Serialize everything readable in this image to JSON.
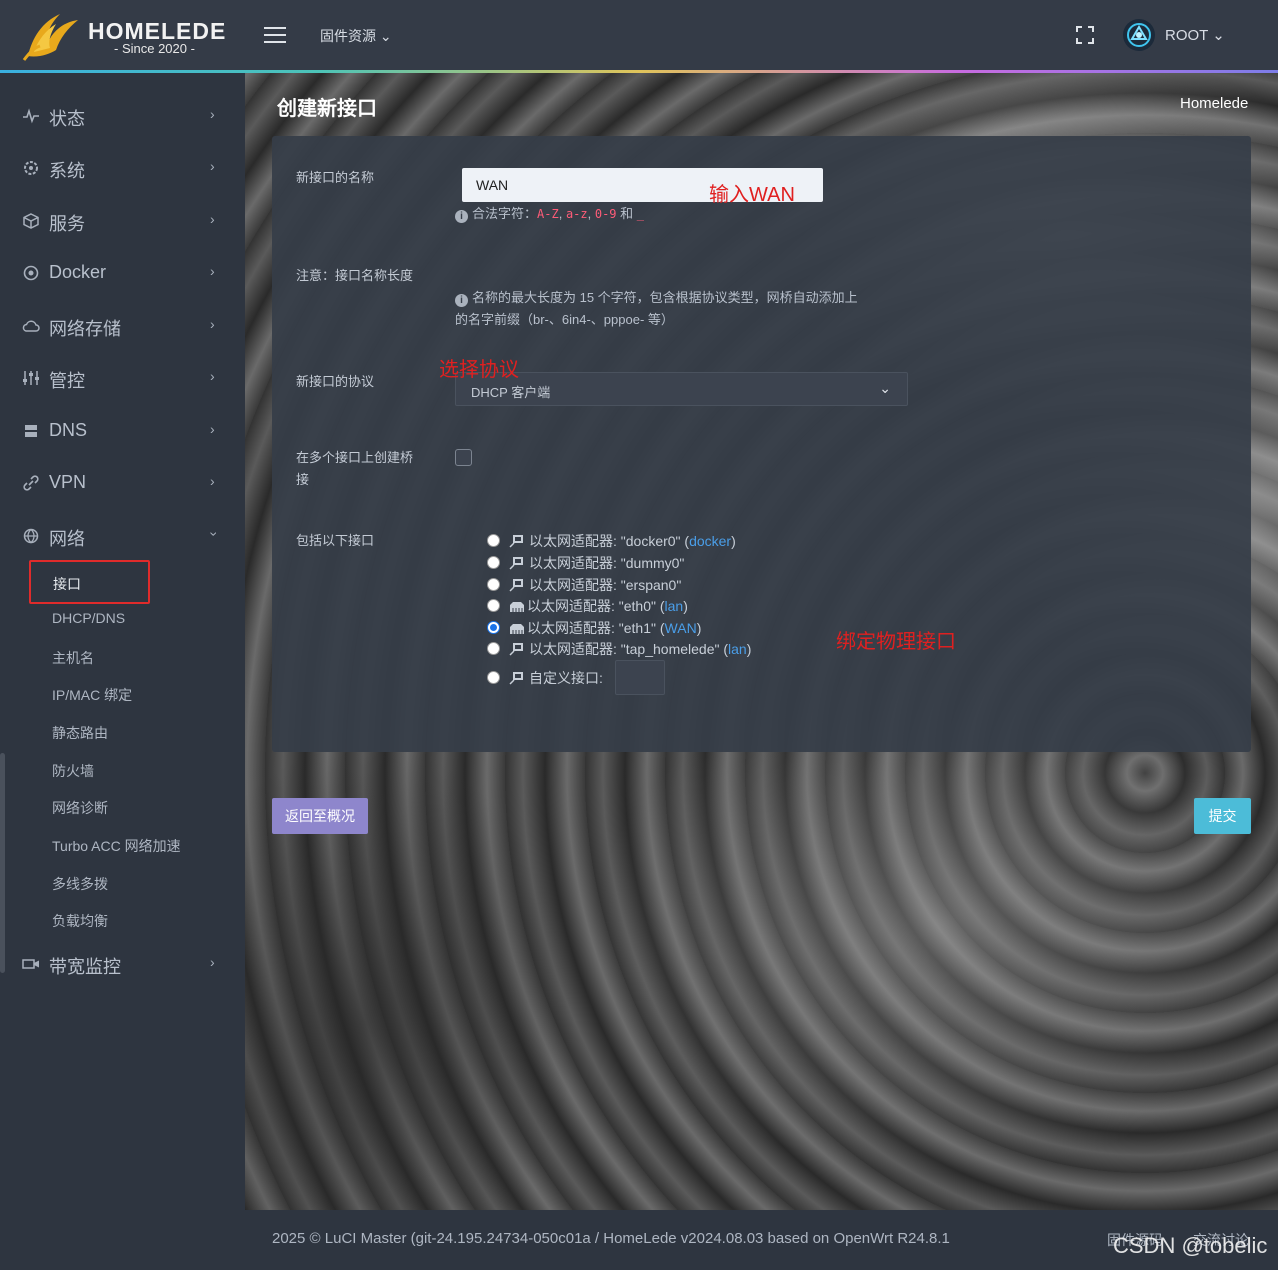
{
  "header": {
    "logo_title": "HOMELEDE",
    "logo_subtitle": "- Since 2020 -",
    "firmware_menu": "固件资源 ⌄",
    "user": "ROOT ⌄"
  },
  "sidebar": {
    "items": [
      {
        "label": "状态",
        "icon": "pulse-icon"
      },
      {
        "label": "系统",
        "icon": "gear-icon"
      },
      {
        "label": "服务",
        "icon": "cube-icon"
      },
      {
        "label": "Docker",
        "icon": "target-icon"
      },
      {
        "label": "网络存储",
        "icon": "cloud-icon"
      },
      {
        "label": "管控",
        "icon": "sliders-icon"
      },
      {
        "label": "DNS",
        "icon": "server-icon"
      },
      {
        "label": "VPN",
        "icon": "link-icon"
      },
      {
        "label": "网络",
        "icon": "globe-icon"
      },
      {
        "label": "带宽监控",
        "icon": "camera-icon"
      }
    ],
    "network_sub": [
      "接口",
      "DHCP/DNS",
      "主机名",
      "IP/MAC 绑定",
      "静态路由",
      "防火墙",
      "网络诊断",
      "Turbo ACC 网络加速",
      "多线多拨",
      "负载均衡"
    ]
  },
  "page": {
    "title": "创建新接口",
    "breadcrumb": "Homelede"
  },
  "form": {
    "name_label": "新接口的名称",
    "name_value": "WAN",
    "name_hint_prefix": "合法字符：",
    "name_hint_code1": "A-Z",
    "name_hint_sep1": ", ",
    "name_hint_code2": "a-z",
    "name_hint_sep2": ", ",
    "name_hint_code3": "0-9",
    "name_hint_and": " 和 ",
    "name_hint_code4": "_",
    "note_label": "注意：接口名称长度",
    "note_hint_line1": "名称的最大长度为 15 个字符，包含根据协议类型，网桥自动添加上",
    "note_hint_line2": "的名字前缀（br-、6in4-、pppoe- 等）",
    "protocol_label": "新接口的协议",
    "protocol_value": "DHCP 客户端",
    "bridge_label_line1": "在多个接口上创建桥",
    "bridge_label_line2": "接",
    "include_label": "包括以下接口",
    "interfaces": [
      {
        "text": "以太网适配器: \"docker0\" (",
        "link": "docker",
        "tail": ")",
        "checked": false
      },
      {
        "text": "以太网适配器: \"dummy0\"",
        "link": "",
        "tail": "",
        "checked": false
      },
      {
        "text": "以太网适配器: \"erspan0\"",
        "link": "",
        "tail": "",
        "checked": false
      },
      {
        "text": "以太网适配器: \"eth0\" (",
        "link": "lan",
        "tail": ")",
        "checked": false
      },
      {
        "text": "以太网适配器: \"eth1\" (",
        "link": "WAN",
        "tail": ")",
        "checked": true
      },
      {
        "text": "以太网适配器: \"tap_homelede\" (",
        "link": "lan",
        "tail": ")",
        "checked": false
      }
    ],
    "custom_label": "自定义接口:"
  },
  "annotations": {
    "enter_wan": "输入WAN",
    "select_protocol": "选择协议",
    "bind_physical": "绑定物理接口"
  },
  "buttons": {
    "back": "返回至概况",
    "submit": "提交"
  },
  "footer": {
    "text": "2025 © LuCI Master (git-24.195.24734-050c01a / HomeLede v2024.08.03 based on OpenWrt R24.8.1",
    "link1": "固件源码",
    "link2": "交流讨论"
  },
  "watermark": "CSDN @tobelic",
  "colors": {
    "annotation_red": "#e02020",
    "link_blue": "#4a9ee8",
    "back_button": "#8e86cc",
    "submit_button": "#4cbcd8"
  }
}
